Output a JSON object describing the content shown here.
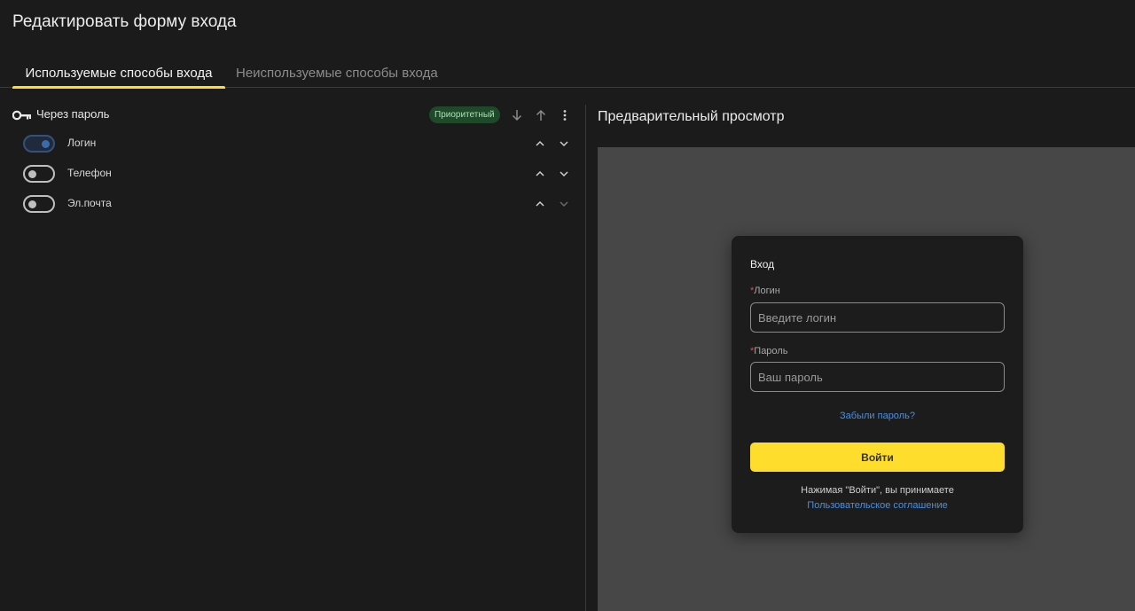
{
  "page": {
    "title": "Редактировать форму входа"
  },
  "tabs": [
    {
      "label": "Используемые способы входа",
      "active": true
    },
    {
      "label": "Неиспользуемые способы входа",
      "active": false
    }
  ],
  "group": {
    "title": "Через пароль",
    "icon": "key-icon",
    "badge": "Приоритетный",
    "actions": [
      "arrow-down-icon",
      "arrow-up-icon",
      "more-vertical-icon"
    ]
  },
  "methods": [
    {
      "label": "Логин",
      "enabled": true
    },
    {
      "label": "Телефон",
      "enabled": false
    },
    {
      "label": "Эл.почта",
      "enabled": false
    }
  ],
  "preview": {
    "title": "Предварительный просмотр",
    "card": {
      "title": "Вход",
      "required_mark": "*",
      "login_label": "Логин",
      "login_placeholder": "Введите логин",
      "password_label": "Пароль",
      "password_placeholder": "Ваш пароль",
      "forgot_link": "Забыли пароль?",
      "submit_label": "Войти",
      "terms_text": "Нажимая \"Войти\", вы принимаете",
      "terms_link": "Пользовательское соглашение"
    }
  },
  "colors": {
    "background": "#1b1b1b",
    "accent": "#ffdd2d",
    "link": "#4a90e2",
    "badge_bg": "#1f4a2a",
    "preview_bg": "#474747"
  }
}
